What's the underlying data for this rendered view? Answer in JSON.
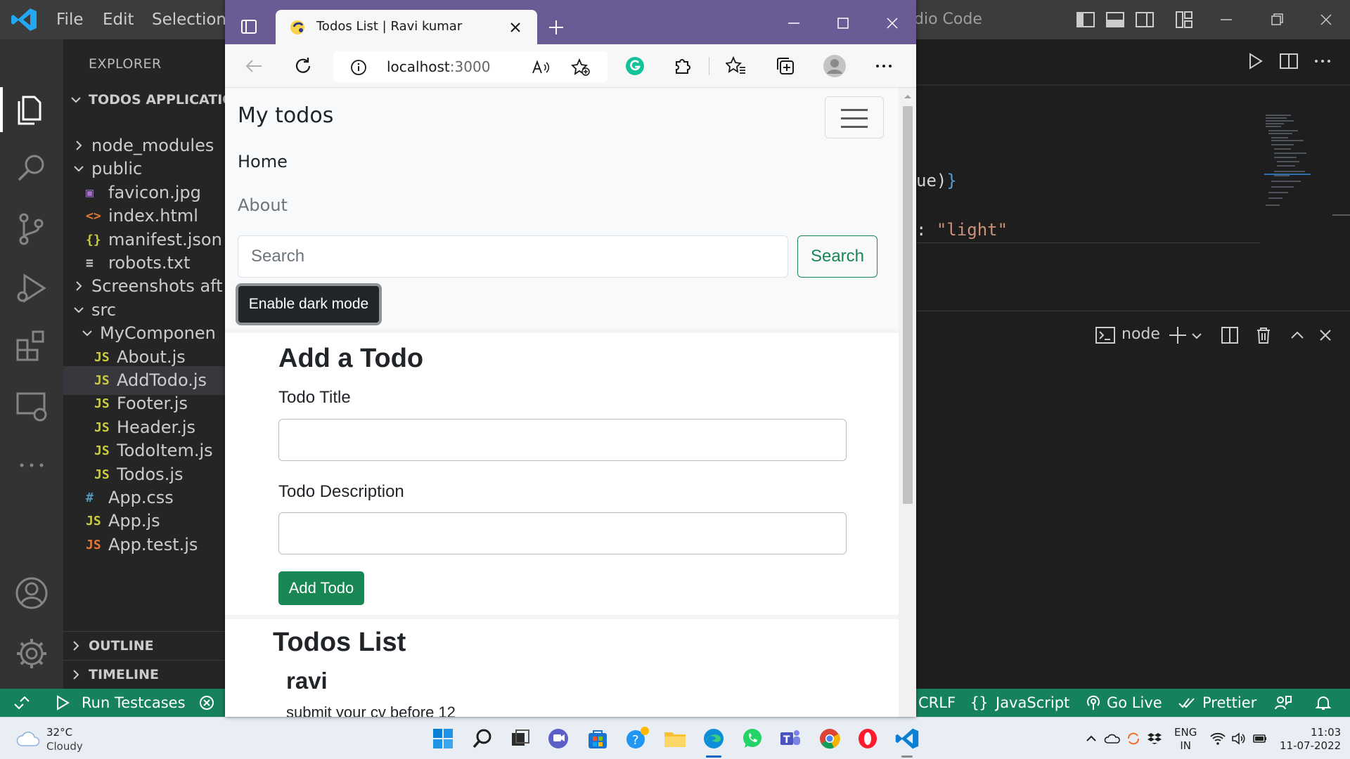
{
  "vscode": {
    "menu": [
      "File",
      "Edit",
      "Selection"
    ],
    "title_fragment": "dio Code",
    "explorer_header": "EXPLORER",
    "workspace_title": "TODOS APPLICATIO",
    "tree": [
      {
        "label": "node_modules",
        "kind": "folder",
        "collapsed": true
      },
      {
        "label": "public",
        "kind": "folder",
        "collapsed": false
      },
      {
        "label": "favicon.jpg",
        "kind": "file",
        "icon": "image-file-icon"
      },
      {
        "label": "index.html",
        "kind": "file",
        "icon": "html-file-icon"
      },
      {
        "label": "manifest.json",
        "kind": "file",
        "icon": "json-file-icon"
      },
      {
        "label": "robots.txt",
        "kind": "file",
        "icon": "text-file-icon"
      },
      {
        "label": "Screenshots aft",
        "kind": "folder",
        "collapsed": true
      },
      {
        "label": "src",
        "kind": "folder",
        "collapsed": false
      },
      {
        "label": "MyComponen",
        "kind": "folder",
        "collapsed": false
      },
      {
        "label": "About.js",
        "kind": "file",
        "icon": "js-file-icon"
      },
      {
        "label": "AddTodo.js",
        "kind": "file",
        "icon": "js-file-icon",
        "selected": true
      },
      {
        "label": "Footer.js",
        "kind": "file",
        "icon": "js-file-icon"
      },
      {
        "label": "Header.js",
        "kind": "file",
        "icon": "js-file-icon"
      },
      {
        "label": "TodoItem.js",
        "kind": "file",
        "icon": "js-file-icon"
      },
      {
        "label": "Todos.js",
        "kind": "file",
        "icon": "js-file-icon"
      },
      {
        "label": "App.css",
        "kind": "file",
        "icon": "css-file-icon"
      },
      {
        "label": "App.js",
        "kind": "file",
        "icon": "js-file-icon"
      },
      {
        "label": "App.test.js",
        "kind": "file",
        "icon": "js-test-file-icon"
      }
    ],
    "outline_label": "OUTLINE",
    "timeline_label": "TIMELINE",
    "code": {
      "line1_text": "ue)",
      "line1_brace": "}",
      "line2_colon": ": ",
      "line2_string": "\"light\""
    },
    "terminal_label": "node",
    "status": {
      "run_testcases": "Run Testcases",
      "crlf": "CRLF",
      "language": "JavaScript",
      "go_live": "Go Live",
      "prettier": "Prettier"
    },
    "colors": {
      "status_bar": "#16825d",
      "title_bar": "#3c3c3c",
      "activity_bar": "#333333",
      "sidebar": "#252526"
    }
  },
  "browser": {
    "tab_title": "Todos List | Ravi kumar",
    "url_host": "localhost",
    "url_port": ":3000",
    "colors": {
      "tab_bar": "#6b5b95",
      "accent_green": "#198754"
    }
  },
  "app": {
    "brand": "My todos",
    "nav": {
      "home": "Home",
      "about": "About"
    },
    "search_placeholder": "Search",
    "search_button": "Search",
    "dark_mode_button": "Enable dark mode",
    "add_todo": {
      "heading": "Add a Todo",
      "title_label": "Todo Title",
      "desc_label": "Todo Description",
      "button": "Add Todo"
    },
    "todos_list": {
      "heading": "Todos List",
      "items": [
        {
          "title": "ravi",
          "description": "submit your cv before 12"
        }
      ]
    }
  },
  "taskbar": {
    "temperature": "32°C",
    "condition": "Cloudy",
    "language": "ENG",
    "region": "IN",
    "time": "11:03",
    "date": "11-07-2022"
  }
}
